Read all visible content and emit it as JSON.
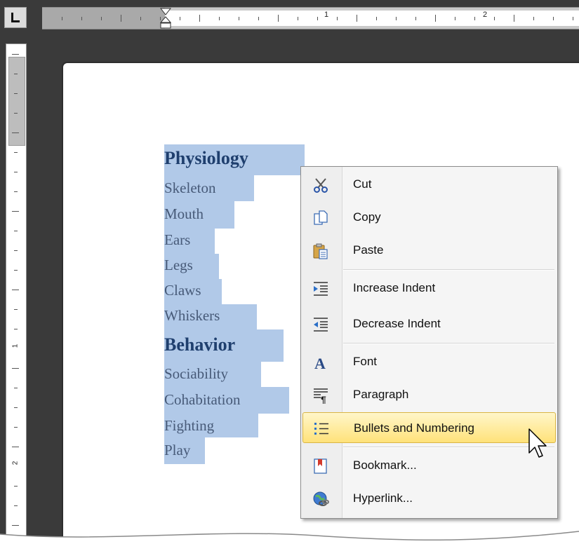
{
  "document": {
    "lines": [
      {
        "text": "Physiology",
        "kind": "heading"
      },
      {
        "text": "Skeleton",
        "kind": "item"
      },
      {
        "text": "Mouth",
        "kind": "item"
      },
      {
        "text": "Ears",
        "kind": "item"
      },
      {
        "text": "Legs",
        "kind": "item"
      },
      {
        "text": "Claws",
        "kind": "item"
      },
      {
        "text": "Whiskers",
        "kind": "item"
      },
      {
        "text": "Behavior",
        "kind": "heading"
      },
      {
        "text": "Sociability",
        "kind": "item"
      },
      {
        "text": "Cohabitation",
        "kind": "item"
      },
      {
        "text": "Fighting",
        "kind": "item"
      },
      {
        "text": "Play",
        "kind": "item"
      }
    ],
    "selection_color": "#b1c9e8"
  },
  "ruler": {
    "horizontal_numbers": [
      "1",
      "2"
    ],
    "vertical_numbers": [
      "1",
      "2"
    ]
  },
  "context_menu": {
    "items": [
      {
        "label": "Cut",
        "icon": "scissors-icon"
      },
      {
        "label": "Copy",
        "icon": "copy-icon"
      },
      {
        "label": "Paste",
        "icon": "paste-icon"
      },
      {
        "label": "Increase Indent",
        "icon": "increase-indent-icon"
      },
      {
        "label": "Decrease Indent",
        "icon": "decrease-indent-icon"
      },
      {
        "label": "Font",
        "icon": "font-icon"
      },
      {
        "label": "Paragraph",
        "icon": "paragraph-icon"
      },
      {
        "label": "Bullets and Numbering",
        "icon": "bullets-icon",
        "highlighted": true
      },
      {
        "label": "Bookmark...",
        "icon": "bookmark-icon"
      },
      {
        "label": "Hyperlink...",
        "icon": "hyperlink-icon"
      }
    ],
    "highlight_color": "#ffe27a"
  }
}
